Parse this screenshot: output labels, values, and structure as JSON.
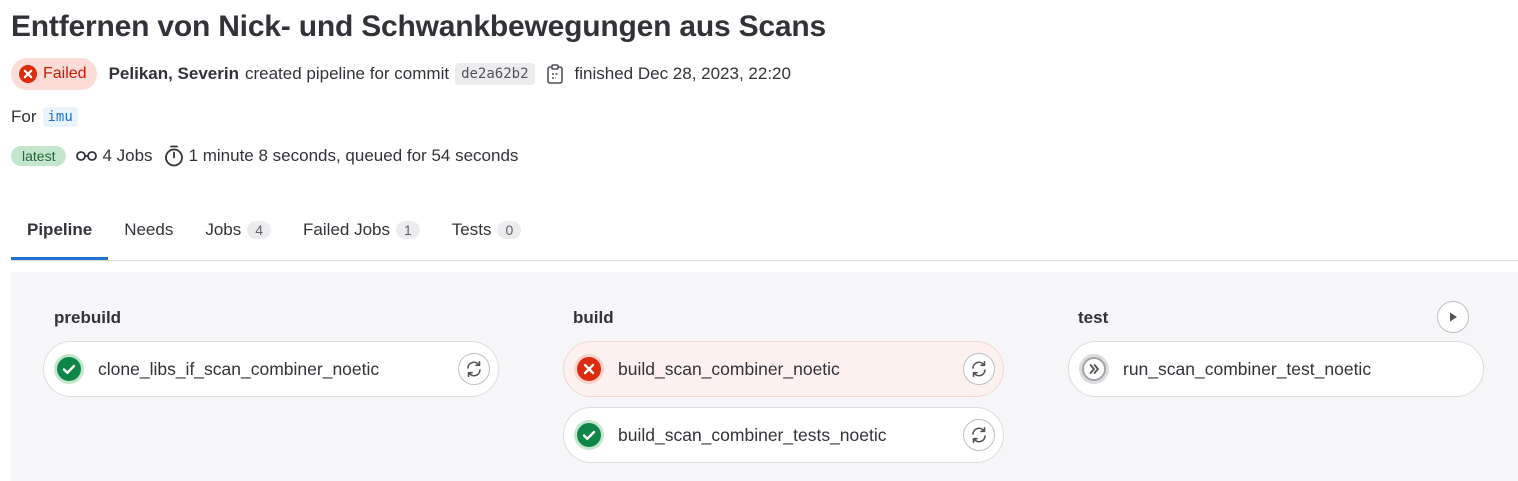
{
  "pipeline": {
    "title": "Entfernen von Nick- und Schwankbewegungen aus Scans",
    "status": "Failed",
    "author": "Pelikan, Severin",
    "created_text": "created pipeline for commit",
    "commit_sha": "de2a62b2",
    "finished_text": "finished Dec 28, 2023, 22:20",
    "for_label": "For",
    "ref": "imu",
    "latest_badge": "latest",
    "jobs_count_text": "4 Jobs",
    "duration_text": "1 minute 8 seconds, queued for 54 seconds"
  },
  "tabs": [
    {
      "label": "Pipeline",
      "count": null
    },
    {
      "label": "Needs",
      "count": null
    },
    {
      "label": "Jobs",
      "count": "4"
    },
    {
      "label": "Failed Jobs",
      "count": "1"
    },
    {
      "label": "Tests",
      "count": "0"
    }
  ],
  "stages": [
    {
      "name": "prebuild",
      "jobs": [
        {
          "name": "clone_libs_if_scan_combiner_noetic",
          "status": "success",
          "icon": "check-circle-icon",
          "action": "retry-icon"
        }
      ]
    },
    {
      "name": "build",
      "jobs": [
        {
          "name": "build_scan_combiner_noetic",
          "status": "failed",
          "icon": "x-circle-icon",
          "action": "retry-icon"
        },
        {
          "name": "build_scan_combiner_tests_noetic",
          "status": "success",
          "icon": "check-circle-icon",
          "action": "retry-icon"
        }
      ]
    },
    {
      "name": "test",
      "jobs": [
        {
          "name": "run_scan_combiner_test_noetic",
          "status": "skipped",
          "icon": "skipped-icon",
          "action": null
        }
      ]
    }
  ],
  "colors": {
    "failed": "#dd2b0e",
    "success": "#108548",
    "accent": "#1f75cb"
  }
}
